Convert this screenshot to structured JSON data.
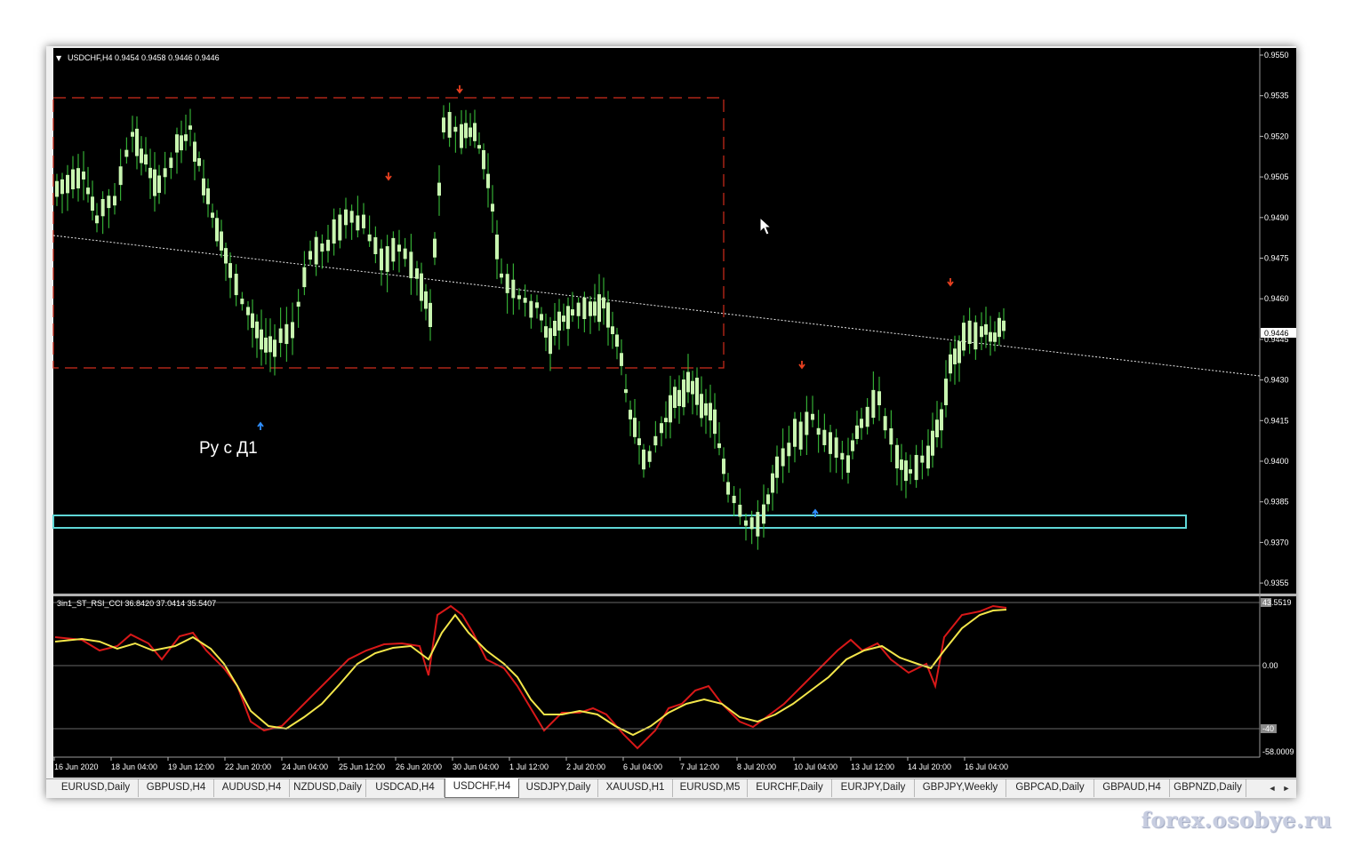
{
  "main_chart": {
    "symbol_header": "USDCHF,H4  0.9454 0.9458 0.9446 0.9446",
    "price_labels": [
      "0.9550",
      "0.9535",
      "0.9520",
      "0.9505",
      "0.9490",
      "0.9475",
      "0.9460",
      "0.9445",
      "0.9430",
      "0.9415",
      "0.9400",
      "0.9385",
      "0.9370",
      "0.9355"
    ],
    "current_price": "0.9446",
    "annotation": "Ру с Д1"
  },
  "indicator": {
    "header": "3in1_ST_RSI_CCI 36.8420 37.0414 35.5407",
    "scale_labels": [
      "43.5519",
      "0.00",
      "-40",
      "-58.0009"
    ]
  },
  "time_labels": [
    "16 Jun 2020",
    "18 Jun 04:00",
    "19 Jun 12:00",
    "22 Jun 20:00",
    "24 Jun 04:00",
    "25 Jun 12:00",
    "26 Jun 20:00",
    "30 Jun 04:00",
    "1 Jul 12:00",
    "2 Jul 20:00",
    "6 Jul 04:00",
    "7 Jul 12:00",
    "8 Jul 20:00",
    "10 Jul 04:00",
    "13 Jul 12:00",
    "14 Jul 20:00",
    "16 Jul 04:00"
  ],
  "tabs": [
    "EURUSD,Daily",
    "GBPUSD,H4",
    "AUDUSD,H4",
    "NZDUSD,Daily",
    "USDCAD,H4",
    "USDCHF,H4",
    "USDJPY,Daily",
    "XAUUSD,H1",
    "EURUSD,M5",
    "EURCHF,Daily",
    "EURJPY,Daily",
    "GBPJPY,Weekly",
    "GBPCAD,Daily",
    "GBPAUD,H4",
    "GBPNZD,Daily"
  ],
  "active_tab": "USDCHF,H4",
  "watermark": "forex.osobye.ru",
  "colors": {
    "background": "#000000",
    "candle": "#c8f5b0",
    "wick": "#3ecf3e",
    "zone": "#d02c1c",
    "support": "#5fd6d6",
    "rsi": "#d81818",
    "signal": "#f3e64a",
    "arrow_up": "#2f8fff",
    "arrow_down": "#e84020"
  }
}
